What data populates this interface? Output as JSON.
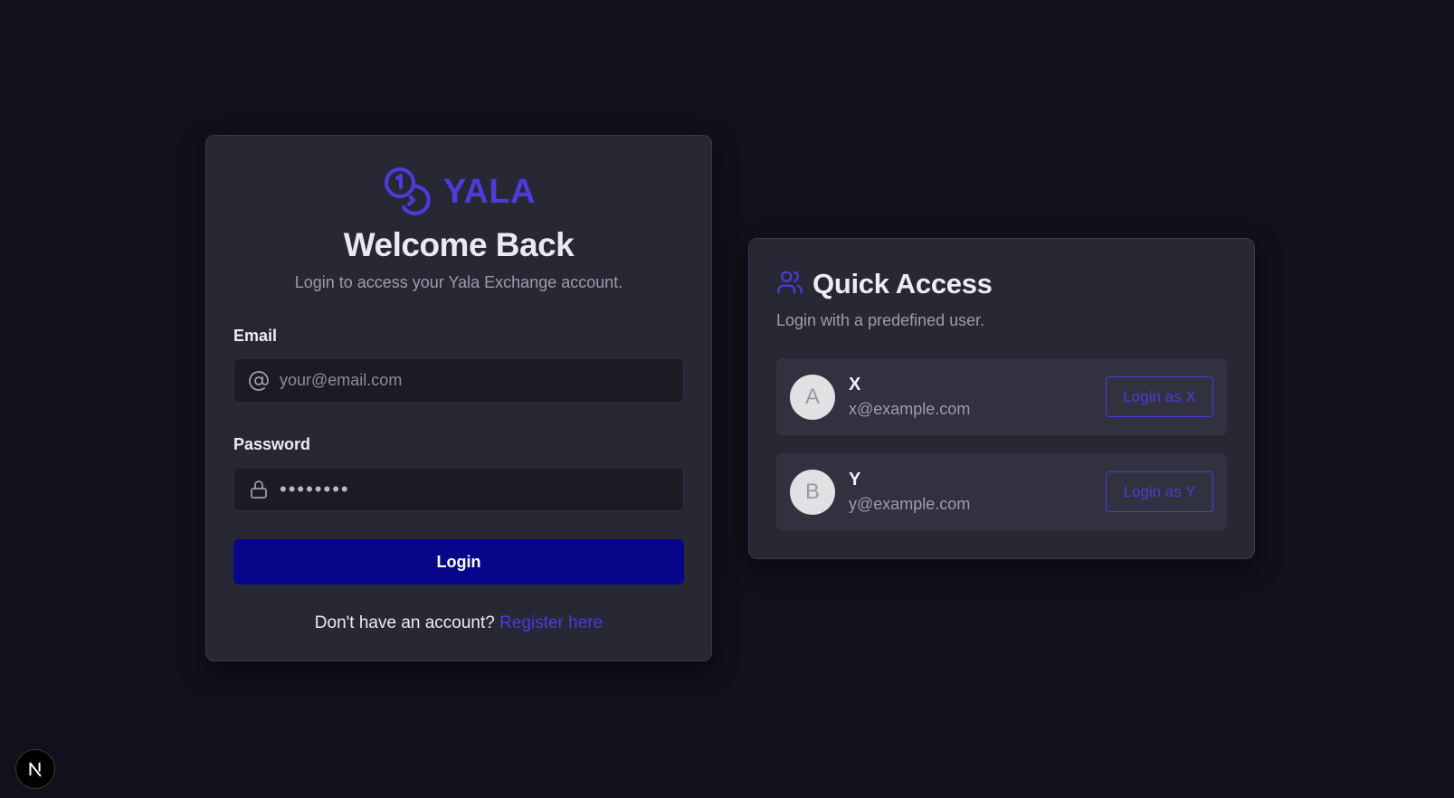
{
  "brand": {
    "name": "YALA",
    "accent": "#4a3ddb",
    "logo_icon": "coins-icon"
  },
  "login": {
    "heading": "Welcome Back",
    "subtitle": "Login to access your Yala Exchange account.",
    "email_label": "Email",
    "email_placeholder": "your@email.com",
    "email_icon": "at-sign-icon",
    "password_label": "Password",
    "password_value": "••••••••",
    "password_icon": "lock-icon",
    "submit_label": "Login",
    "submit_color": "#07068a",
    "register_prompt": "Don't have an account?",
    "register_link": "Register here"
  },
  "quick_access": {
    "title": "Quick Access",
    "title_icon": "users-icon",
    "subtitle": "Login with a predefined user.",
    "users": [
      {
        "initial": "A",
        "name": "X",
        "email": "x@example.com",
        "button": "Login as X"
      },
      {
        "initial": "B",
        "name": "Y",
        "email": "y@example.com",
        "button": "Login as Y"
      }
    ]
  },
  "dev_badge": {
    "letter": "N",
    "icon": "nextjs-icon"
  }
}
